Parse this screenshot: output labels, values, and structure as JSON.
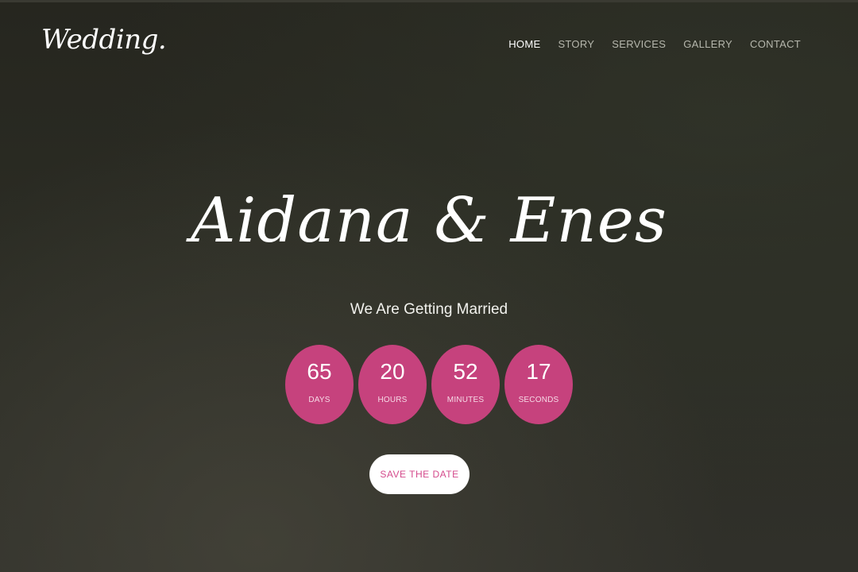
{
  "brand": {
    "logo": "Wedding."
  },
  "nav": {
    "items": [
      {
        "label": "HOME",
        "active": true
      },
      {
        "label": "STORY",
        "active": false
      },
      {
        "label": "SERVICES",
        "active": false
      },
      {
        "label": "GALLERY",
        "active": false
      },
      {
        "label": "CONTACT",
        "active": false
      }
    ]
  },
  "hero": {
    "title": "Aidana & Enes",
    "subtitle": "We Are Getting Married",
    "countdown": [
      {
        "value": "65",
        "label": "DAYS"
      },
      {
        "value": "20",
        "label": "HOURS"
      },
      {
        "value": "52",
        "label": "MINUTES"
      },
      {
        "value": "17",
        "label": "SECONDS"
      }
    ],
    "cta_label": "SAVE THE DATE"
  },
  "colors": {
    "accent": "#c6427d",
    "cta_text": "#d44a8c",
    "background": "#2b2c24"
  }
}
